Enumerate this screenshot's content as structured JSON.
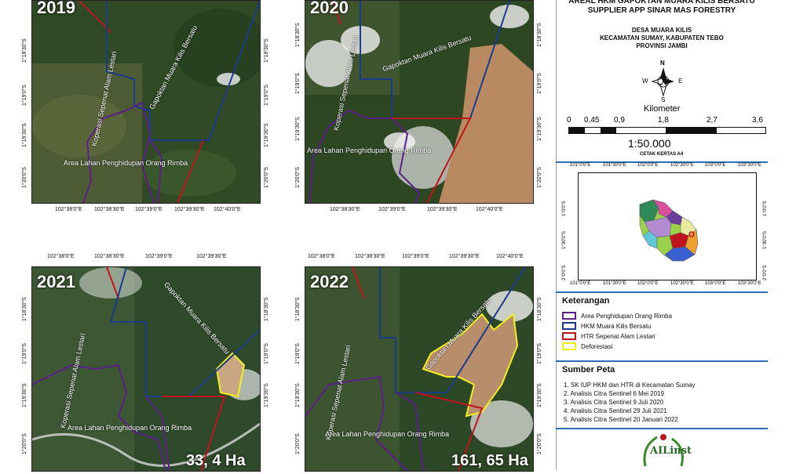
{
  "title": {
    "line1": "AREAL HKM GAPOKTAN MUARA KILIS BERSATU",
    "line2": "SUPPLIER APP SINAR MAS FORESTRY",
    "loc1": "DESA MUARA KILIS",
    "loc2": "KECAMATAN SUMAY, KABUPATEN TEBO",
    "loc3": "PROVINSI JAMBI"
  },
  "compass": {
    "n": "N",
    "s": "S",
    "e": "E",
    "w": "W"
  },
  "scalebar": {
    "unit": "Kilometer",
    "ticks": [
      "0",
      "0,45",
      "0,9",
      "1,8",
      "2,7",
      "3,6"
    ],
    "ratio": "1:50.000",
    "paper": "CETAK KERTAS A4"
  },
  "inset": {
    "top_ticks": [
      "101°0'0\"E",
      "101°30'0\"E",
      "102°0'0\"E",
      "102°30'0\"E",
      "103°0'0\"E",
      "103°30'0\"E"
    ],
    "bottom_ticks": [
      "101°0'0\"E",
      "101°30'0\"E",
      "102°0'0\"E",
      "102°30'0\"E",
      "103°0'0\"E",
      "103°30'0\"E"
    ],
    "left_ticks": [
      "1°0'0\"S",
      "1°30'0\"S",
      "2°0'0\"S"
    ],
    "right_ticks": [
      "1°0'0\"S",
      "1°30'0\"S",
      "2°0'0\"S"
    ]
  },
  "legend": {
    "title": "Keterangan",
    "items": [
      {
        "label": "Area Penghidupan Orang Rimba",
        "color": "#5b1f8a"
      },
      {
        "label": "HKM Muara Kilis Bersatu",
        "color": "#1a3a8a"
      },
      {
        "label": "HTR Sepenat Alam Lestari",
        "color": "#c0141c"
      },
      {
        "label": "Deforestasi",
        "color": "#f2ee22"
      }
    ]
  },
  "sources": {
    "title": "Sumber Peta",
    "items": [
      "1. SK IUP HKM dan HTR di Kecamatan Sumay",
      "2. Analisis Citra Sentinel 6 Mei 2019",
      "3. Analisis Citra Sentinel 9 Juli 2020",
      "4. Analisis Citra Sentinel 29 Juli 2021",
      "5. Analisis Citra Sentinel 20 Januari 2022"
    ]
  },
  "logo_text": "AILinst",
  "maps": [
    {
      "year": "2019",
      "area": "",
      "labels": {
        "gapoktan": "Gapoktan Muara Kilis Bersatu",
        "koperasi": "Koperasi Sepenat Alam Lestari",
        "orang_rimba": "Area Lahan Penghidupan Orang Rimba"
      },
      "top_ticks": [],
      "bottom_ticks": [
        "102°38'0\"E",
        "102°38'30\"E",
        "102°39'0\"E",
        "102°39'30\"E",
        "102°40'0\"E"
      ],
      "left_ticks": [
        "1°18'30\"S",
        "1°19'0\"S",
        "1°19'30\"S",
        "1°20'0\"S"
      ],
      "right_ticks": [
        "1°18'30\"S",
        "1°19'0\"S",
        "1°19'30\"S",
        "1°20'0\"S"
      ]
    },
    {
      "year": "2020",
      "area": "",
      "labels": {
        "gapoktan": "Gapoktan Muara Kilis Bersatu",
        "koperasi": "Koperasi Sepenat Alam Lestari",
        "orang_rimba": "Area Lahan Penghidupan Orang Rimba"
      },
      "top_ticks": [],
      "bottom_ticks": [
        "102°38'30\"E",
        "102°39'0\"E",
        "102°39'30\"E",
        "102°40'0\"E"
      ],
      "left_ticks": [
        "1°18'30\"S",
        "1°19'0\"S",
        "1°19'30\"S",
        "1°20'0\"S"
      ],
      "right_ticks": [
        "1°18'30\"S",
        "1°19'0\"S",
        "1°19'30\"S",
        "1°20'0\"S"
      ]
    },
    {
      "year": "2021",
      "area": "33, 4 Ha",
      "labels": {
        "gapoktan": "Gapoktan Muara Kilis Bersatu",
        "koperasi": "Koperasi Sepenat Alam Lestari",
        "orang_rimba": "Area Lahan Penghidupan Orang Rimba"
      },
      "top_ticks": [
        "102°38'0\"E",
        "102°38'30\"E",
        "102°39'0\"E",
        "102°39'30\"E"
      ],
      "bottom_ticks": [],
      "left_ticks": [
        "1°18'30\"S",
        "1°19'0\"S",
        "1°19'30\"S",
        "1°20'0\"S"
      ],
      "right_ticks": [
        "1°18'30\"S",
        "1°19'0\"S",
        "1°19'30\"S"
      ]
    },
    {
      "year": "2022",
      "area": "161, 65 Ha",
      "labels": {
        "gapoktan": "Gapoktan Muara Kilis Bersatu",
        "koperasi": "Koperasi Sepenat Alam Lestari",
        "orang_rimba": "Area Lahan Penghidupan Orang Rimba"
      },
      "top_ticks": [
        "102°38'0\"E",
        "102°38'30\"E",
        "102°39'0\"E",
        "102°39'30\"E",
        "102°40'0\"E"
      ],
      "bottom_ticks": [],
      "left_ticks": [
        "1°18'30\"S",
        "1°19'0\"S",
        "1°19'30\"S",
        "1°20'0\"S"
      ],
      "right_ticks": [
        "1°18'30\"S",
        "1°19'0\"S",
        "1°19'30\"S",
        "1°20'0\"S"
      ]
    }
  ]
}
